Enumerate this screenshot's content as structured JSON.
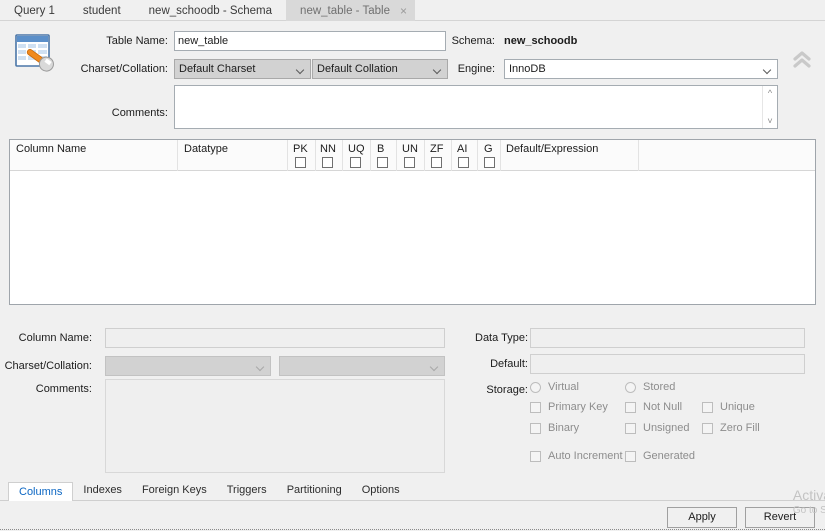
{
  "editor_tabs": [
    {
      "label": "Query 1",
      "active": false,
      "closable": false
    },
    {
      "label": "student",
      "active": false,
      "closable": false
    },
    {
      "label": "new_schoodb - Schema",
      "active": false,
      "closable": false
    },
    {
      "label": "new_table - Table",
      "active": true,
      "closable": true,
      "close_glyph": "×"
    }
  ],
  "header": {
    "icon_name": "table-wrench-icon",
    "table_name_label": "Table Name:",
    "table_name_value": "new_table",
    "schema_label": "Schema:",
    "schema_value": "new_schoodb",
    "charset_collation_label": "Charset/Collation:",
    "charset_value": "Default Charset",
    "collation_value": "Default Collation",
    "engine_label": "Engine:",
    "engine_value": "InnoDB",
    "comments_label": "Comments:",
    "comments_value": "",
    "collapse_icon": "chevron-double-up-icon"
  },
  "grid": {
    "columns": [
      {
        "key": "column_name",
        "label": "Column Name"
      },
      {
        "key": "datatype",
        "label": "Datatype"
      },
      {
        "key": "pk",
        "label": "PK"
      },
      {
        "key": "nn",
        "label": "NN"
      },
      {
        "key": "uq",
        "label": "UQ"
      },
      {
        "key": "b",
        "label": "B"
      },
      {
        "key": "un",
        "label": "UN"
      },
      {
        "key": "zf",
        "label": "ZF"
      },
      {
        "key": "ai",
        "label": "AI"
      },
      {
        "key": "g",
        "label": "G"
      },
      {
        "key": "default_expression",
        "label": "Default/Expression"
      }
    ],
    "rows": []
  },
  "detail": {
    "column_name_label": "Column Name:",
    "column_name_value": "",
    "charset_collation_label": "Charset/Collation:",
    "charset_value": "",
    "collation_value": "",
    "comments_label": "Comments:",
    "comments_value": "",
    "data_type_label": "Data Type:",
    "data_type_value": "",
    "default_label": "Default:",
    "default_value": "",
    "storage_label": "Storage:",
    "storage_radios": [
      {
        "label": "Virtual",
        "checked": false
      },
      {
        "label": "Stored",
        "checked": false
      }
    ],
    "flags": [
      {
        "label": "Primary Key",
        "checked": false
      },
      {
        "label": "Not Null",
        "checked": false
      },
      {
        "label": "Unique",
        "checked": false
      },
      {
        "label": "Binary",
        "checked": false
      },
      {
        "label": "Unsigned",
        "checked": false
      },
      {
        "label": "Zero Fill",
        "checked": false
      },
      {
        "label": "Auto Increment",
        "checked": false
      },
      {
        "label": "Generated",
        "checked": false
      }
    ]
  },
  "bottom_tabs": [
    {
      "label": "Columns",
      "active": true
    },
    {
      "label": "Indexes",
      "active": false
    },
    {
      "label": "Foreign Keys",
      "active": false
    },
    {
      "label": "Triggers",
      "active": false
    },
    {
      "label": "Partitioning",
      "active": false
    },
    {
      "label": "Options",
      "active": false
    }
  ],
  "footer": {
    "apply_label": "Apply",
    "revert_label": "Revert"
  },
  "watermark": {
    "line1": "Activa",
    "line2": "Go to S"
  },
  "colors": {
    "accent": "#0b66c3",
    "window_bg": "#f0f0f0",
    "field_bg": "#ffffff",
    "disabled_bg": "#efefef",
    "combo_gray": "#d2d2d2",
    "border": "#a5acb2",
    "active_tab_bg": "#d9d9d9"
  }
}
